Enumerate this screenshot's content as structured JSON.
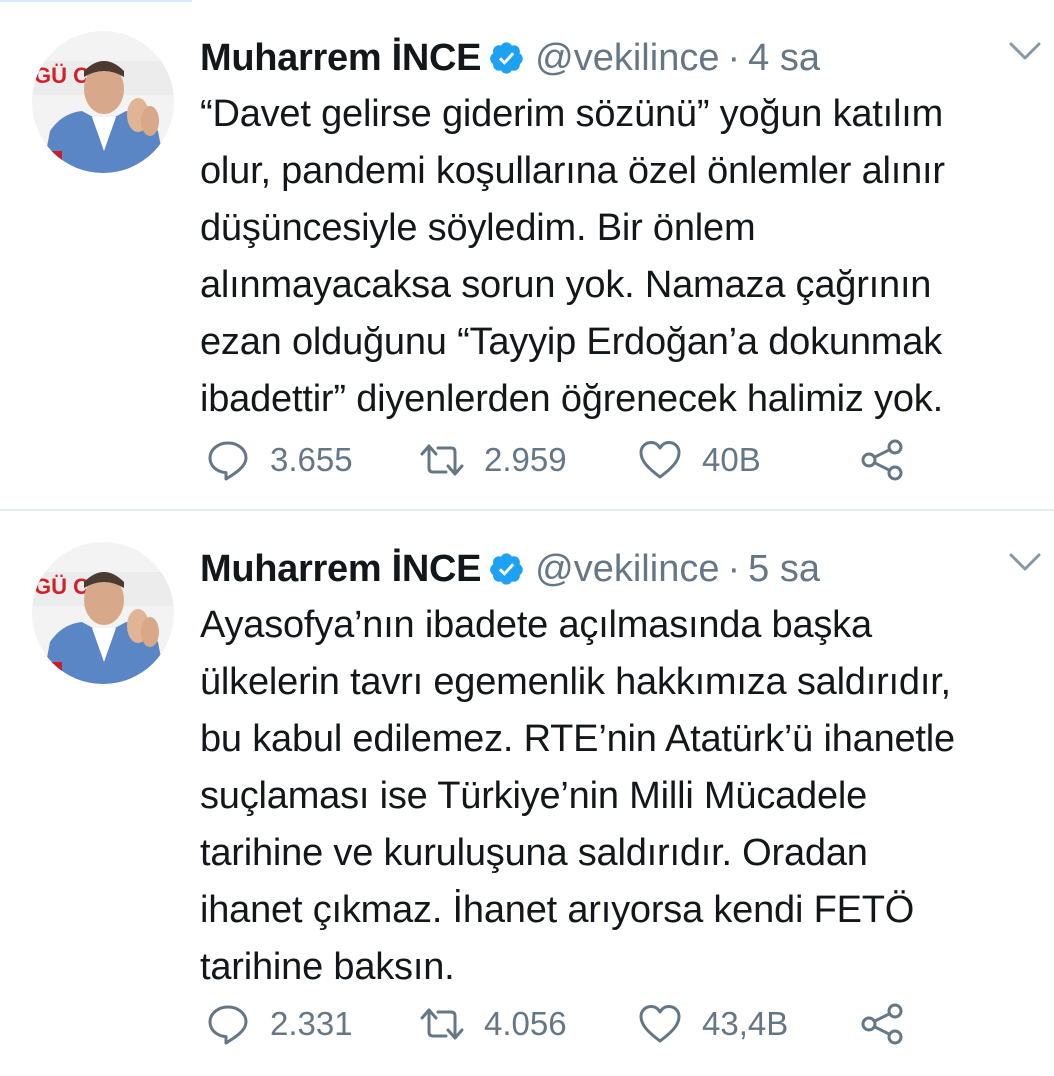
{
  "tweets": [
    {
      "name": "Muharrem İNCE",
      "handle": "@vekilince",
      "separator": "·",
      "time": "4 sa",
      "text": "“Davet gelirse giderim sözünü” yoğun katılım\nolur, pandemi koşullarına özel önlemler alınır\ndüşüncesiyle söyledim. Bir önlem\nalınmayacaksa sorun yok. Namaza çağrının\nezan olduğunu “Tayyip Erdoğan’a dokunmak\nibadettir” diyenlerden öğrenecek halimiz yok.",
      "replies": "3.655",
      "retweets": "2.959",
      "likes": "40B",
      "avatar_text": "GÜ CE"
    },
    {
      "name": "Muharrem İNCE",
      "handle": "@vekilince",
      "separator": "·",
      "time": "5 sa",
      "text": "Ayasofya’nın ibadete açılmasında başka\nülkelerin tavrı egemenlik hakkımıza saldırıdır,\nbu kabul edilemez. RTE’nin Atatürk’ü ihanetle\nsuçlaması ise Türkiye’nin Milli Mücadele\ntarihine ve kuruluşuna saldırıdır. Oradan\nihanet çıkmaz. İhanet arıyorsa kendi FETÖ\ntarihine baksın.",
      "replies": "2.331",
      "retweets": "4.056",
      "likes": "43,4B",
      "avatar_text": "GÜ CE"
    }
  ],
  "colors": {
    "text": "#14171a",
    "secondary": "#657786",
    "verified": "#1da1f2",
    "divider": "#e6ecf0"
  },
  "icons": {
    "verified": "verified-badge-icon",
    "caret": "chevron-down-icon",
    "reply": "reply-bubble-icon",
    "retweet": "retweet-icon",
    "like": "heart-icon",
    "share": "share-icon"
  }
}
